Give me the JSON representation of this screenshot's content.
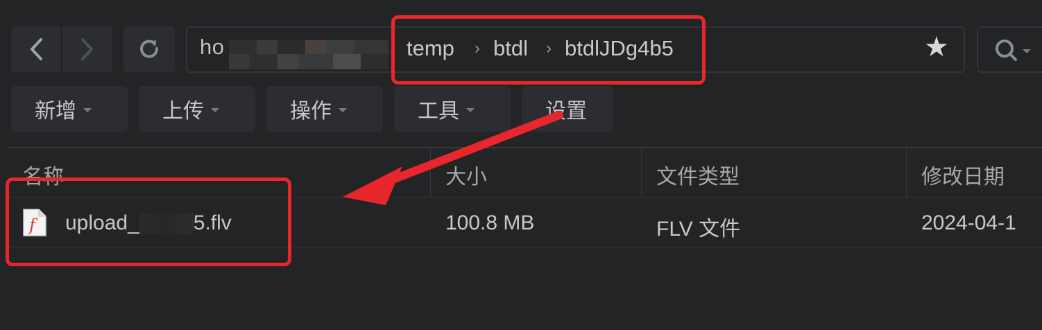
{
  "address": {
    "host": "ho",
    "crumbs": [
      "temp",
      "btdl",
      "btdlJDg4b5"
    ]
  },
  "toolbar": [
    {
      "label": "新增",
      "has_menu": true
    },
    {
      "label": "上传",
      "has_menu": true
    },
    {
      "label": "操作",
      "has_menu": true
    },
    {
      "label": "工具",
      "has_menu": true
    },
    {
      "label": "设置",
      "has_menu": false
    }
  ],
  "table": {
    "headers": {
      "name": "名称",
      "size": "大小",
      "type": "文件类型",
      "modified": "修改日期"
    },
    "rows": [
      {
        "name_prefix": "upload_",
        "name_suffix": "5.flv",
        "size": "100.8 MB",
        "type": "FLV 文件",
        "modified": "2024-04-1"
      }
    ]
  },
  "colors": {
    "annotation": "#e8262b",
    "background": "#232426"
  }
}
